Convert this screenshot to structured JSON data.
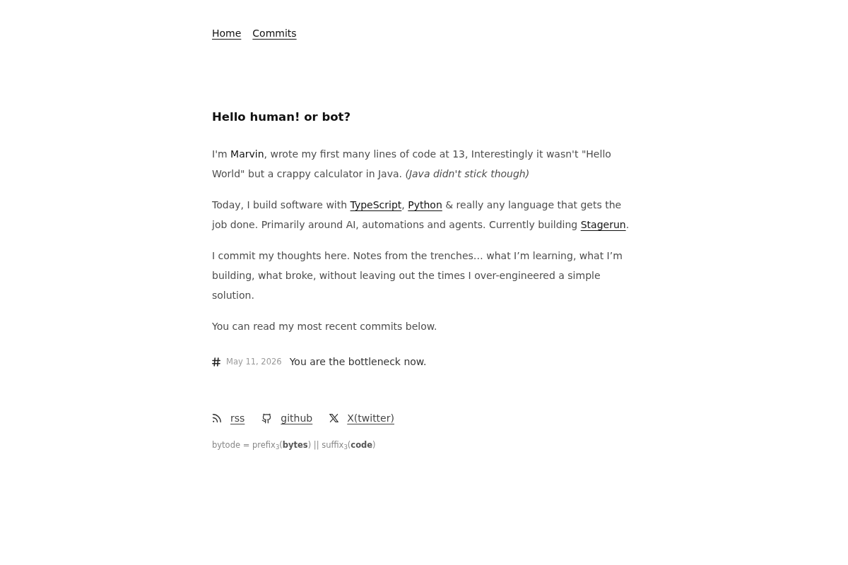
{
  "nav": [
    {
      "label": "Home"
    },
    {
      "label": "Commits"
    }
  ],
  "heading": "Hello human! or bot?",
  "paragraphs": [
    [
      {
        "kind": "text",
        "text": "I'm **Marvin**, wrote my first many lines of code at 13, Interestingly it wasn't \"Hello World\" but a crappy calculator in Java. *(Java didn't stick though)*"
      }
    ],
    [
      {
        "kind": "text",
        "text": "Today, I build software with "
      },
      {
        "kind": "link",
        "text": "TypeScript"
      },
      {
        "kind": "text",
        "text": ", "
      },
      {
        "kind": "link",
        "text": "Python"
      },
      {
        "kind": "text",
        "text": " & really any language that gets the job done. Primarily around AI, automations and agents. Currently building "
      },
      {
        "kind": "link",
        "text": "Stagerun"
      },
      {
        "kind": "text",
        "text": "."
      }
    ],
    [
      {
        "kind": "text",
        "text": "I commit my thoughts here. Notes from the trenches… what I’m learning, what I’m building, what broke, without leaving out the times I over-engineered a simple solution."
      }
    ],
    [
      {
        "kind": "text",
        "text": "You can read my most recent commits below."
      }
    ]
  ],
  "commits": [
    {
      "date": "May 11, 2026",
      "title": "You are the bottleneck now."
    }
  ],
  "social_links": [
    {
      "kind": "rss",
      "label": "rss"
    },
    {
      "kind": "github",
      "label": "github"
    },
    {
      "kind": "x",
      "label": "X(twitter)"
    }
  ],
  "footer": "bytode = prefix$_{3}$(**bytes**) || suffix$_{3}$(**code**)"
}
